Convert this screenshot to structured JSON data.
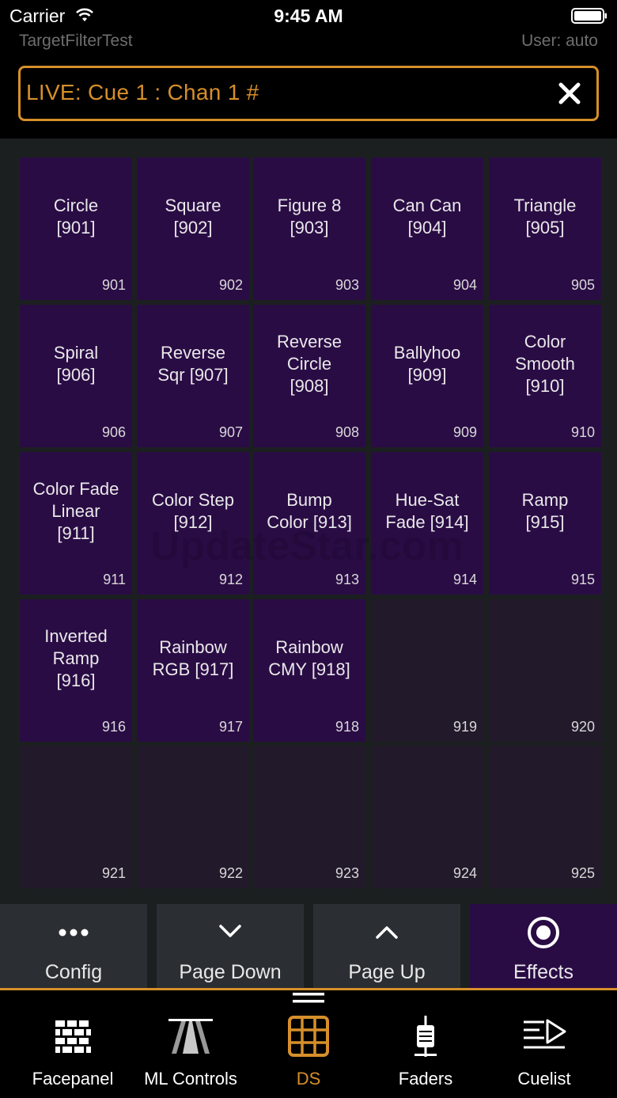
{
  "status_bar": {
    "carrier": "Carrier",
    "time": "9:45 AM"
  },
  "header": {
    "show_name": "TargetFilterTest",
    "user": "User: auto",
    "command_line": "LIVE: Cue  1 : Chan 1 #"
  },
  "colors": {
    "accent": "#d68f2a",
    "tile_filled": "#2a0c45",
    "tile_empty": "#22192a",
    "background": "#1c1f20"
  },
  "watermark": "UpdateStar.com",
  "tiles": [
    {
      "label": "Circle\n[901]",
      "number": "901"
    },
    {
      "label": "Square\n[902]",
      "number": "902"
    },
    {
      "label": "Figure 8\n[903]",
      "number": "903"
    },
    {
      "label": "Can Can\n[904]",
      "number": "904"
    },
    {
      "label": "Triangle\n[905]",
      "number": "905"
    },
    {
      "label": "Spiral\n[906]",
      "number": "906"
    },
    {
      "label": "Reverse\nSqr [907]",
      "number": "907"
    },
    {
      "label": "Reverse\nCircle\n[908]",
      "number": "908"
    },
    {
      "label": "Ballyhoo\n[909]",
      "number": "909"
    },
    {
      "label": "Color\nSmooth\n[910]",
      "number": "910"
    },
    {
      "label": "Color Fade\nLinear\n[911]",
      "number": "911"
    },
    {
      "label": "Color Step\n[912]",
      "number": "912"
    },
    {
      "label": "Bump\nColor [913]",
      "number": "913"
    },
    {
      "label": "Hue-Sat\nFade [914]",
      "number": "914"
    },
    {
      "label": "Ramp\n[915]",
      "number": "915"
    },
    {
      "label": "Inverted\nRamp\n[916]",
      "number": "916"
    },
    {
      "label": "Rainbow\nRGB [917]",
      "number": "917"
    },
    {
      "label": "Rainbow\nCMY [918]",
      "number": "918"
    },
    {
      "label": "",
      "number": "919"
    },
    {
      "label": "",
      "number": "920"
    },
    {
      "label": "",
      "number": "921"
    },
    {
      "label": "",
      "number": "922"
    },
    {
      "label": "",
      "number": "923"
    },
    {
      "label": "",
      "number": "924"
    },
    {
      "label": "",
      "number": "925"
    }
  ],
  "function_buttons": [
    {
      "label": "Config",
      "icon": "more-dots-icon"
    },
    {
      "label": "Page Down",
      "icon": "chevron-down-icon"
    },
    {
      "label": "Page Up",
      "icon": "chevron-up-icon"
    },
    {
      "label": "Effects",
      "icon": "effects-circle-icon",
      "active": true
    }
  ],
  "tabs": [
    {
      "label": "Facepanel",
      "icon": "facepanel-icon"
    },
    {
      "label": "ML Controls",
      "icon": "ml-controls-icon"
    },
    {
      "label": "DS",
      "icon": "ds-grid-icon",
      "active": true
    },
    {
      "label": "Faders",
      "icon": "fader-icon"
    },
    {
      "label": "Cuelist",
      "icon": "cuelist-icon"
    }
  ]
}
